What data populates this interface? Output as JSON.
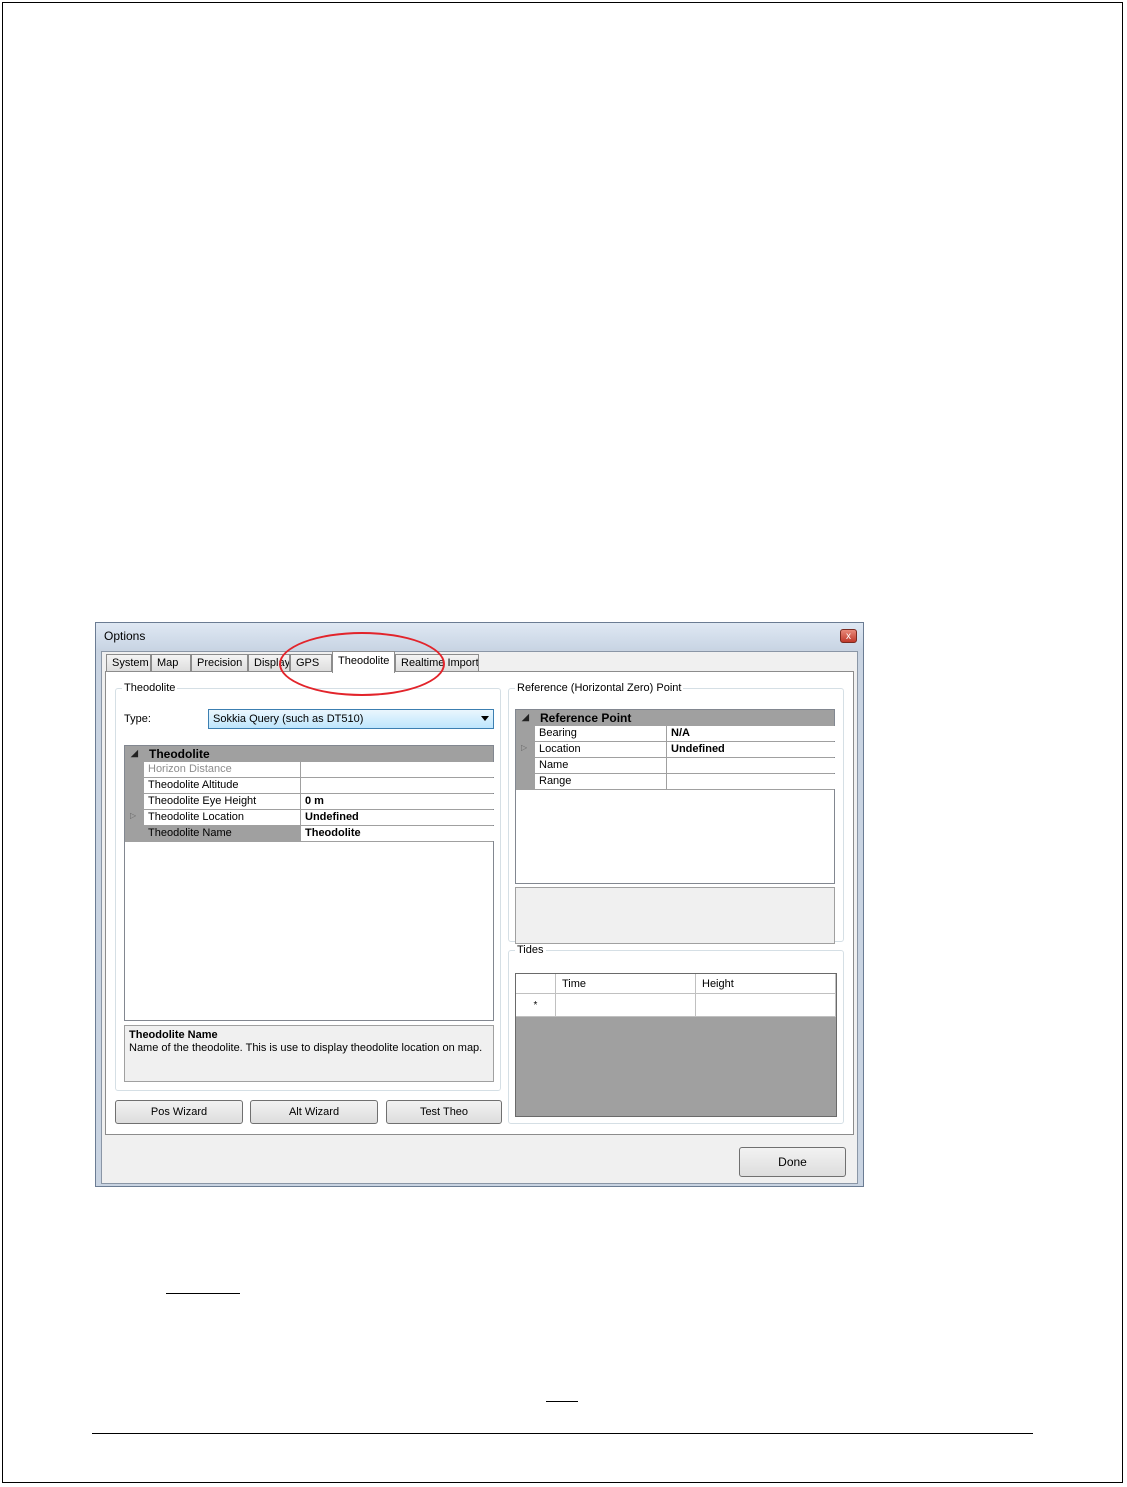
{
  "window": {
    "title": "Options",
    "close_label": "x"
  },
  "tabs": [
    {
      "label": "System"
    },
    {
      "label": "Map"
    },
    {
      "label": "Precision"
    },
    {
      "label": "Display"
    },
    {
      "label": "GPS"
    },
    {
      "label": "Theodolite",
      "active": true
    },
    {
      "label": "Realtime Imports"
    }
  ],
  "theodolite_group": {
    "legend": "Theodolite",
    "type_label": "Type:",
    "type_value": "Sokkia Query (such as DT510)",
    "category": "Theodolite",
    "properties": [
      {
        "name": "Horizon Distance",
        "value": ""
      },
      {
        "name": "Theodolite Altitude",
        "value": ""
      },
      {
        "name": "Theodolite Eye Height",
        "value": "0 m"
      },
      {
        "name": "Theodolite Location",
        "value": "Undefined"
      },
      {
        "name": "Theodolite Name",
        "value": "Theodolite"
      }
    ],
    "help_title": "Theodolite Name",
    "help_desc": "Name of the theodolite. This is use to display theodolite location on map."
  },
  "reference_group": {
    "legend": "Reference (Horizontal Zero) Point",
    "category": "Reference Point",
    "properties": [
      {
        "name": "Bearing",
        "value": "N/A"
      },
      {
        "name": "Location",
        "value": "Undefined"
      },
      {
        "name": "Name",
        "value": ""
      },
      {
        "name": "Range",
        "value": ""
      }
    ]
  },
  "tides_group": {
    "legend": "Tides",
    "columns": [
      "Time",
      "Height"
    ],
    "new_row_marker": "*"
  },
  "buttons": {
    "pos_wizard": "Pos Wizard",
    "alt_wizard": "Alt Wizard",
    "test_theo": "Test Theo",
    "done": "Done"
  }
}
